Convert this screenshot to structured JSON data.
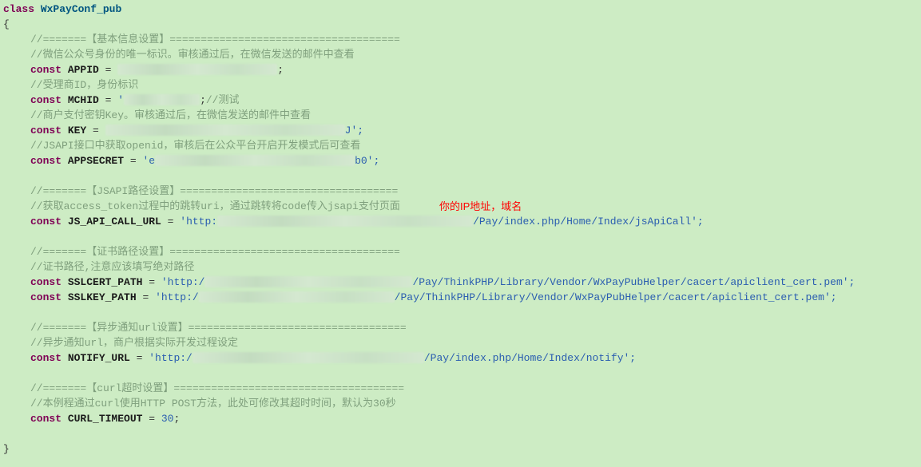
{
  "decl": {
    "class_kw": "class",
    "class_name": "WxPayConf_pub",
    "open_brace": "{",
    "close_brace": "}"
  },
  "sec1": {
    "hdr": "//=======【基本信息设置】=====================================",
    "c_appid": "//微信公众号身份的唯一标识。审核通过后，在微信发送的邮件中查看",
    "const_kw": "const",
    "appid_name": "APPID",
    "eq": " = ",
    "semicolon": ";",
    "c_mchid": "//受理商ID，身份标识",
    "mchid_name": "MCHID",
    "mchid_val_open": "'",
    "mchid_tail": "//测试",
    "c_key": "//商户支付密钥Key。审核通过后，在微信发送的邮件中查看",
    "key_name": "KEY",
    "key_tail": "J';",
    "c_appsecret": "//JSAPI接口中获取openid，审核后在公众平台开启开发模式后可查看",
    "appsecret_name": "APPSECRET",
    "appsecret_open": "'e",
    "appsecret_tail": "b0';"
  },
  "sec2": {
    "hdr": "//=======【JSAPI路径设置】===================================",
    "c1": "//获取access_token过程中的跳转uri，通过跳转将code传入jsapi支付页面",
    "overlay_text": "你的IP地址，域名",
    "name": "JS_API_CALL_URL",
    "val_open": "'http:",
    "val_tail": "/Pay/index.php/Home/Index/jsApiCall';"
  },
  "sec3": {
    "hdr": "//=======【证书路径设置】=====================================",
    "c1": "//证书路径,注意应该填写绝对路径",
    "cert_name": "SSLCERT_PATH",
    "key_name": "SSLKEY_PATH",
    "val_open": "'http:/",
    "cert_tail": "/Pay/ThinkPHP/Library/Vendor/WxPayPubHelper/cacert/apiclient_cert.pem';",
    "key_tail": "/Pay/ThinkPHP/Library/Vendor/WxPayPubHelper/cacert/apiclient_cert.pem';"
  },
  "sec4": {
    "hdr": "//=======【异步通知url设置】===================================",
    "c1": "//异步通知url，商户根据实际开发过程设定",
    "name": "NOTIFY_URL",
    "val_open": "'http:/",
    "val_tail": "/Pay/index.php/Home/Index/notify';"
  },
  "sec5": {
    "hdr": "//=======【curl超时设置】=====================================",
    "c1": "//本例程通过curl使用HTTP POST方法，此处可修改其超时时间，默认为30秒",
    "name": "CURL_TIMEOUT",
    "val": "30"
  }
}
